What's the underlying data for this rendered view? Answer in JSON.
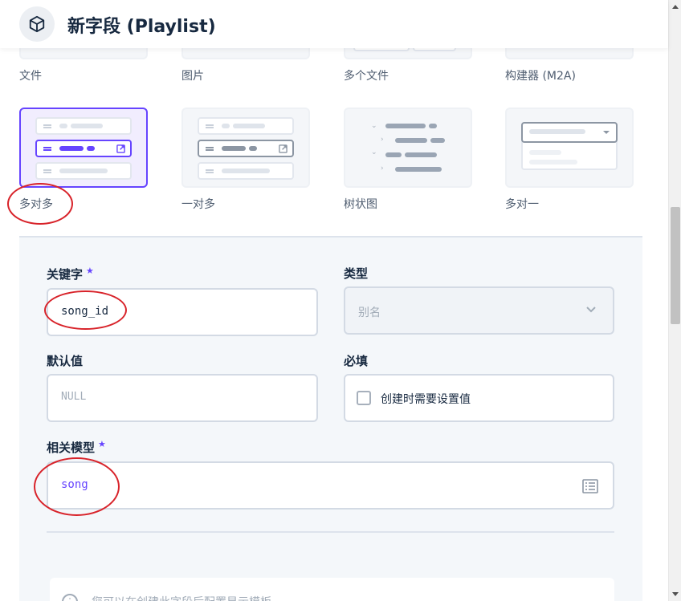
{
  "header": {
    "title": "新字段 (Playlist)",
    "icon": "cube-icon"
  },
  "types_row1": [
    {
      "label": "文件"
    },
    {
      "label": "图片"
    },
    {
      "label": "多个文件"
    },
    {
      "label": "构建器 (M2A)"
    }
  ],
  "types_row2": [
    {
      "label": "多对多",
      "selected": true
    },
    {
      "label": "一对多"
    },
    {
      "label": "树状图"
    },
    {
      "label": "多对一"
    }
  ],
  "form": {
    "key": {
      "label": "关键字",
      "required": "★",
      "value": "song_id"
    },
    "type": {
      "label": "类型",
      "value": "别名"
    },
    "default": {
      "label": "默认值",
      "placeholder": "NULL"
    },
    "required": {
      "label": "必填",
      "checkbox_label": "创建时需要设置值"
    },
    "related": {
      "label": "相关模型",
      "required": "★",
      "value": "song"
    }
  },
  "notice": {
    "text": "您可以在创建此字段后配置显示模板"
  },
  "colors": {
    "accent": "#6644ff",
    "annotation": "#d8232a",
    "text": "#172940"
  }
}
